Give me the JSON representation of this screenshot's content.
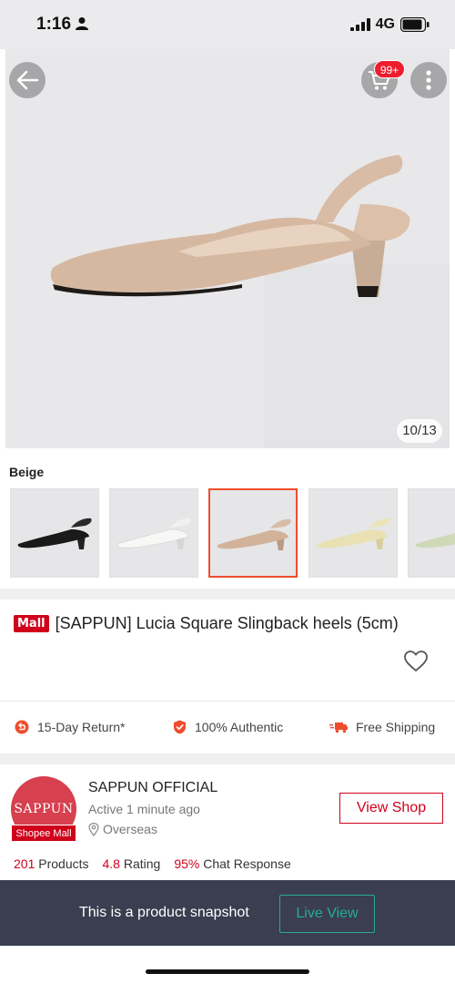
{
  "status_bar": {
    "time": "1:16",
    "network": "4G",
    "icons": [
      "person-icon",
      "signal-icon",
      "battery-icon"
    ]
  },
  "gallery": {
    "counter": "10/13",
    "cart_badge": "99+",
    "icons": [
      "back-arrow-icon",
      "cart-icon",
      "more-icon"
    ]
  },
  "variant": {
    "selected_label": "Beige",
    "colors": [
      "#1d1d1d",
      "#f4f4f2",
      "#d2b39a",
      "#e9e0b4",
      "#cfd9b8"
    ]
  },
  "product": {
    "mall_badge": "Mall",
    "title": "[SAPPUN] Lucia Square Slingback heels (5cm)"
  },
  "guarantees": [
    {
      "label": "15-Day Return*",
      "icon": "return-icon"
    },
    {
      "label": "100% Authentic",
      "icon": "shield-check-icon"
    },
    {
      "label": "Free Shipping",
      "icon": "truck-icon"
    }
  ],
  "shop": {
    "logo_text": "SAPPUN",
    "tag": "Shopee Mall",
    "name": "SAPPUN OFFICIAL",
    "active": "Active 1 minute ago",
    "location": "Overseas",
    "view_shop_label": "View Shop",
    "stats": [
      {
        "value": "201",
        "label": "Products"
      },
      {
        "value": "4.8",
        "label": "Rating"
      },
      {
        "value": "95%",
        "label": "Chat Response"
      }
    ]
  },
  "snapshot": {
    "text": "This is a product snapshot",
    "button_label": "Live View"
  },
  "colors": {
    "accent": "#ee4d2d",
    "mall_red": "#d0011b",
    "teal": "#26aa99",
    "banner_bg": "#3a3e50"
  }
}
